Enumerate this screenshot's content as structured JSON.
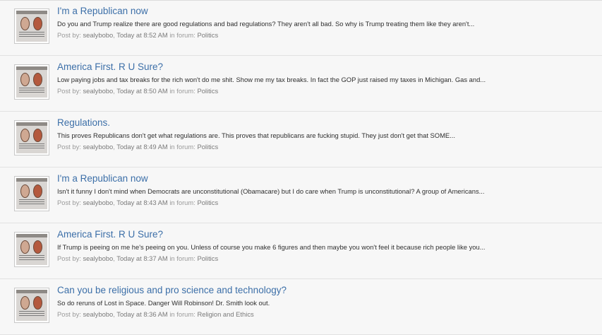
{
  "labels": {
    "post_by": "Post by:",
    "in_forum": "in forum:"
  },
  "results": [
    {
      "title": "I'm a Republican now",
      "snippet": "Do you and Trump realize there are good regulations and bad regulations? They aren't all bad. So why is Trump treating them like they aren't...",
      "author": "sealybobo",
      "time": "Today at 8:52 AM",
      "forum": "Politics"
    },
    {
      "title": "America First. R U Sure?",
      "snippet": "Low paying jobs and tax breaks for the rich won't do me shit. Show me my tax breaks. In fact the GOP just raised my taxes in Michigan. Gas and...",
      "author": "sealybobo",
      "time": "Today at 8:50 AM",
      "forum": "Politics"
    },
    {
      "title": "Regulations.",
      "snippet": "This proves Republicans don't get what regulations are. This proves that republicans are fucking stupid. They just don't get that SOME...",
      "author": "sealybobo",
      "time": "Today at 8:49 AM",
      "forum": "Politics"
    },
    {
      "title": "I'm a Republican now",
      "snippet": "Isn't it funny I don't mind when Democrats are unconstitutional (Obamacare) but I do care when Trump is unconstitutional? A group of Americans...",
      "author": "sealybobo",
      "time": "Today at 8:43 AM",
      "forum": "Politics"
    },
    {
      "title": "America First. R U Sure?",
      "snippet": "If Trump is peeing on me he's peeing on you. Unless of course you make 6 figures and then maybe you won't feel it because rich people like you...",
      "author": "sealybobo",
      "time": "Today at 8:37 AM",
      "forum": "Politics"
    },
    {
      "title": "Can you be religious and pro science and technology?",
      "snippet": "So do reruns of Lost in Space. Danger Will Robinson! Dr. Smith look out.",
      "author": "sealybobo",
      "time": "Today at 8:36 AM",
      "forum": "Religion and Ethics"
    }
  ]
}
